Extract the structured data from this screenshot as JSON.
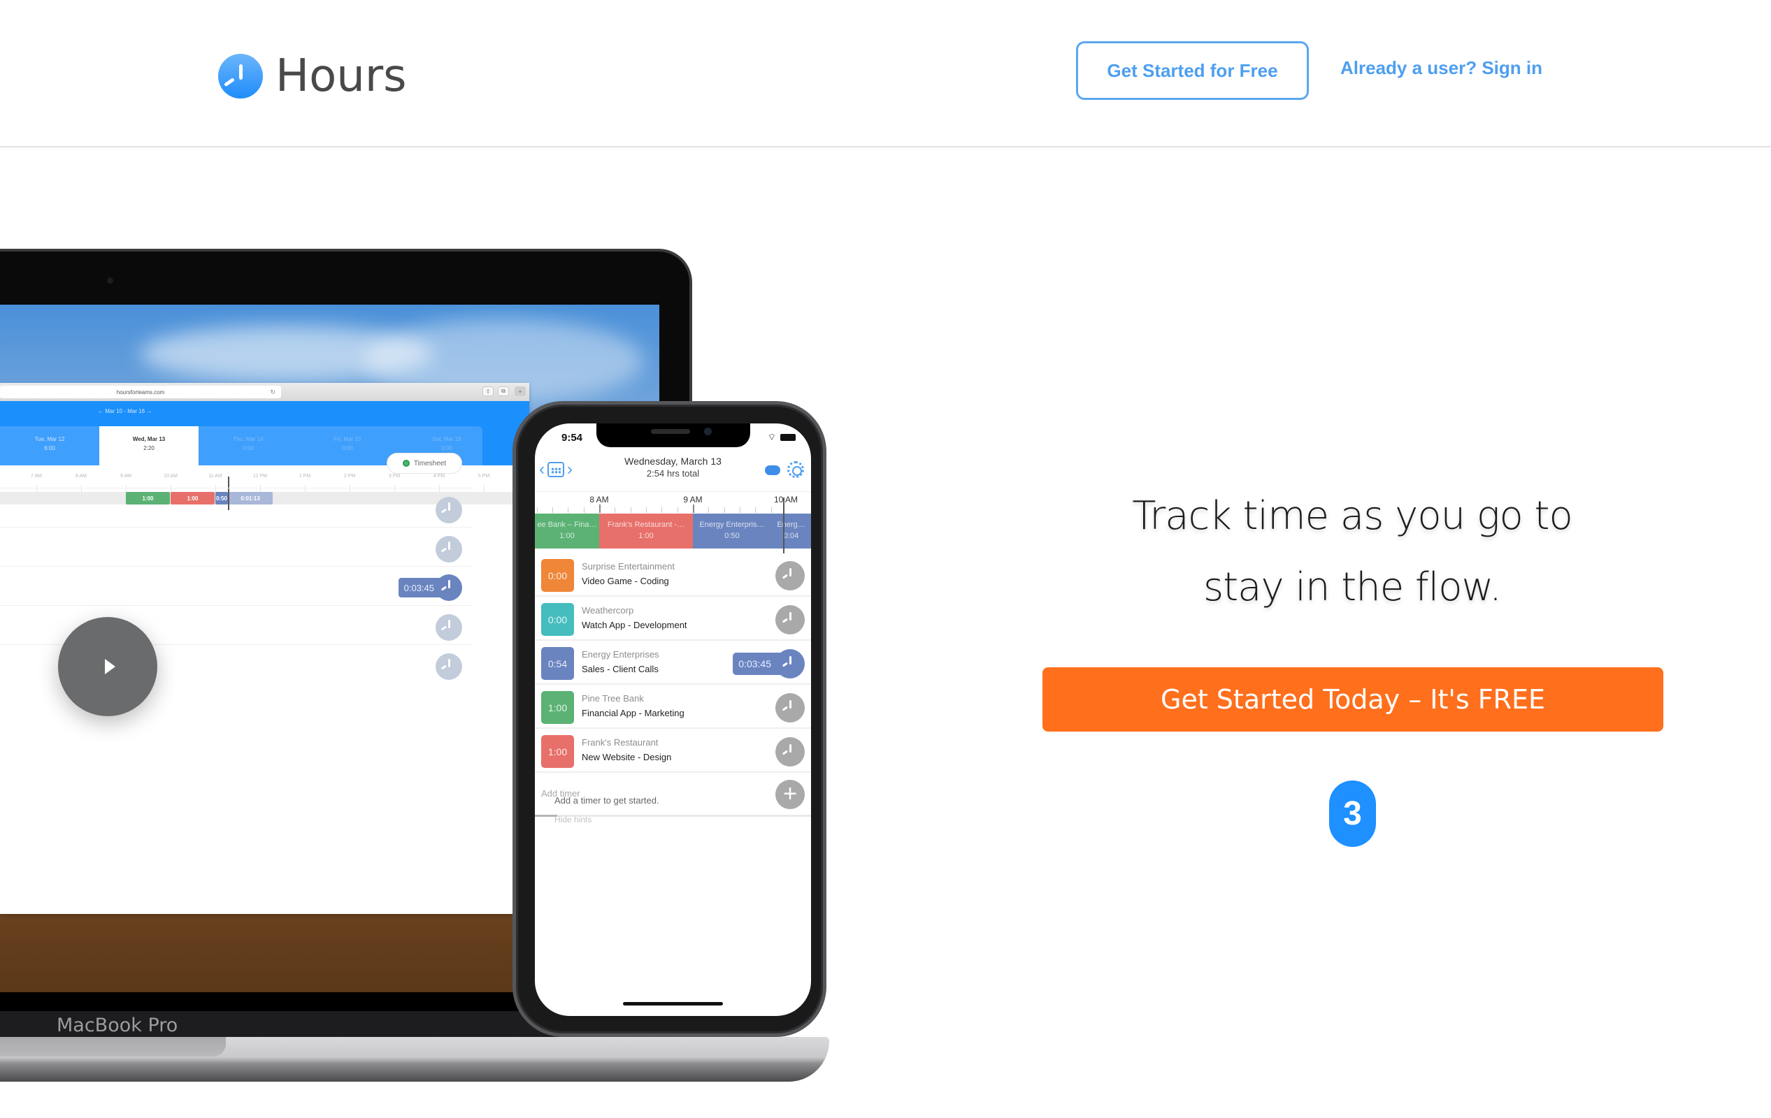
{
  "header": {
    "logo_text": "Hours",
    "get_started_label": "Get Started for Free",
    "signin_label": "Already a user? Sign in"
  },
  "hero": {
    "headline_line1": "Track time as you go to",
    "headline_line2": "stay in the flow.",
    "cta_label": "Get Started Today – It's FREE",
    "badge_count": "3",
    "cta_color": "#ff6f1c",
    "badge_color": "#1e90ff"
  },
  "laptop": {
    "brand_label": "MacBook Pro",
    "browser": {
      "url": "hoursforteams.com",
      "reload_icon": "↻",
      "share_icon": "⇧",
      "tabs_icon": "⧉",
      "new_tab_icon": "+"
    },
    "week_nav": "← Mar 10 - Mar 16 →",
    "days": [
      {
        "title": "Tue, Mar 12",
        "total": "6:00",
        "state": "past"
      },
      {
        "title": "Wed, Mar 13",
        "total": "2:20",
        "state": "active"
      },
      {
        "title": "Thu, Mar 14",
        "total": "0:00",
        "state": "future"
      },
      {
        "title": "Fri, Mar 15",
        "total": "0:00",
        "state": "future"
      },
      {
        "title": "Sat, Mar 16",
        "total": "0:00",
        "state": "future"
      }
    ],
    "hours": [
      "7 AM",
      "8 AM",
      "9 AM",
      "10 AM",
      "11 AM",
      "12 PM",
      "1 PM",
      "2 PM",
      "3 PM",
      "4 PM",
      "5 PM"
    ],
    "segments": [
      {
        "label": "1:00",
        "color": "#5bb274"
      },
      {
        "label": "1:00",
        "color": "#e8706a"
      },
      {
        "label": "0:50",
        "color": "#6a84c0"
      },
      {
        "label": "0:01:13",
        "color": "#a9b7d8"
      }
    ],
    "timesheet_label": "Timesheet",
    "running_timer": "0:03:45",
    "rows": 5,
    "play_icon": "play-icon"
  },
  "phone": {
    "status_time": "9:54",
    "date_title": "Wednesday, March 13",
    "total": "2:54 hrs total",
    "prev_icon": "‹",
    "next_icon": "›",
    "hours": [
      "8 AM",
      "9 AM",
      "10 AM"
    ],
    "segments": [
      {
        "label": "Pine Tree Bank - Fina...",
        "display": "ee Bank – Fina…",
        "duration": "1:00",
        "color": "#5bb274"
      },
      {
        "label": "Frank's Restaurant - ...",
        "display": "Frank's Restaurant -…",
        "duration": "1:00",
        "color": "#e8706a"
      },
      {
        "label": "Energy Enterprises",
        "display": "Energy Enterpris…",
        "duration": "0:50",
        "color": "#6a84c0"
      },
      {
        "label": "Energy Enterprises",
        "display": "Energ…",
        "duration": "0:04",
        "color": "#6a84c0"
      }
    ],
    "timers": [
      {
        "time": "0:00",
        "client": "Surprise Entertainment",
        "project": "Video Game - Coding",
        "color": "#ef8638",
        "running": false
      },
      {
        "time": "0:00",
        "client": "Weathercorp",
        "project": "Watch App - Development",
        "color": "#45bdbf",
        "running": false
      },
      {
        "time": "0:54",
        "client": "Energy Enterprises",
        "project": "Sales - Client Calls",
        "color": "#6a84c0",
        "running": true,
        "elapsed": "0:03:45"
      },
      {
        "time": "1:00",
        "client": "Pine Tree Bank",
        "project": "Financial App - Marketing",
        "color": "#5bb274",
        "running": false
      },
      {
        "time": "1:00",
        "client": "Frank's Restaurant",
        "project": "New Website - Design",
        "color": "#e8706a",
        "running": false
      }
    ],
    "add_timer_placeholder": "Add timer",
    "add_icon": "+",
    "hint": "Add a timer to get started.",
    "hide_hints": "Hide hints"
  }
}
